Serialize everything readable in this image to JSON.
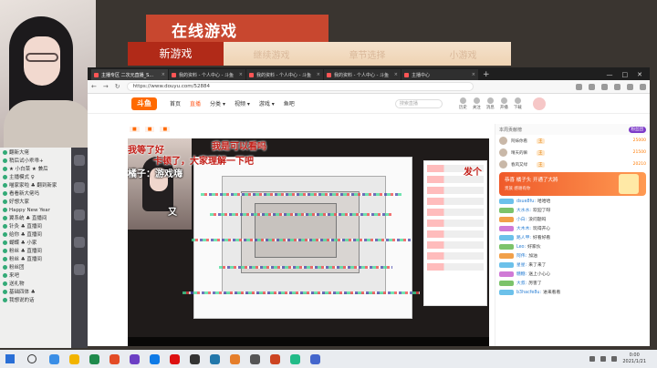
{
  "overlay": {
    "game_title": "在线游戏",
    "menu": [
      "新游戏",
      "继续游戏",
      "章节选择",
      "小游戏"
    ],
    "active_menu_index": 0
  },
  "browser": {
    "tabs": [
      {
        "label": "主播专区 二次元直播_S...",
        "active": true
      },
      {
        "label": "我的资料 - 个人中心 - 斗鱼",
        "active": false
      },
      {
        "label": "我的资料 - 个人中心 - 斗鱼",
        "active": false
      },
      {
        "label": "我的资料 - 个人中心 - 斗鱼",
        "active": false
      },
      {
        "label": "主播中心",
        "active": false
      }
    ],
    "new_tab": "+",
    "window_controls": [
      "—",
      "□",
      "✕"
    ],
    "nav_buttons": [
      "←",
      "→",
      "↻"
    ],
    "url": "https://www.douyu.com/52884"
  },
  "site": {
    "logo": "斗鱼",
    "nav": [
      {
        "label": "首页",
        "active": false
      },
      {
        "label": "直播",
        "active": true
      },
      {
        "label": "分类 ▾",
        "active": false
      },
      {
        "label": "视频 ▾",
        "active": false
      },
      {
        "label": "游戏 ▾",
        "active": false
      },
      {
        "label": "鱼吧",
        "active": false
      }
    ],
    "search_placeholder": "搜索直播",
    "header_icons": [
      "历史",
      "关注",
      "消息",
      "开播",
      "下载"
    ]
  },
  "player": {
    "danmu": [
      {
        "text": "我是可以看吗",
        "style": "red"
      },
      {
        "text": "我等了好",
        "style": "red"
      },
      {
        "text": "卡顿了，大家理解一下吧",
        "style": "red"
      },
      {
        "text": "橘子：游戏嗨",
        "style": "white"
      },
      {
        "text": "又",
        "style": "white"
      },
      {
        "text": "发个",
        "style": "red"
      }
    ]
  },
  "chat_panel": {
    "header": "本周贡献榜",
    "header_pill": "粉丝团",
    "ranks": [
      {
        "name": "阿妹你看",
        "badge": "王",
        "score": "25000"
      },
      {
        "name": "晴天的嘛",
        "badge": "王",
        "score": "21500"
      },
      {
        "name": "春风又绿",
        "badge": "王",
        "score": "20210"
      }
    ],
    "gift_banner": {
      "line1": "恭喜 橘子头 开通了大將",
      "line2": "贵族  感谢有你"
    },
    "messages": [
      {
        "lv": "b",
        "name": "dsue8fu:",
        "text": "哈哈哈"
      },
      {
        "lv": "g",
        "name": "大水水:",
        "text": "欢迎了呀"
      },
      {
        "lv": "o",
        "name": "小白:",
        "text": "没问题吗"
      },
      {
        "lv": "p",
        "name": "大木木:",
        "text": "玩得开心"
      },
      {
        "lv": "b",
        "name": "路人甲:",
        "text": "好看好看"
      },
      {
        "lv": "g",
        "name": "Leo:",
        "text": "好家伙"
      },
      {
        "lv": "o",
        "name": "阿伟:",
        "text": "加油"
      },
      {
        "lv": "b",
        "name": "星星:",
        "text": "来了来了"
      },
      {
        "lv": "p",
        "name": "糖糖:",
        "text": "送上小心心"
      },
      {
        "lv": "g",
        "name": "大叔:",
        "text": "厉害了"
      },
      {
        "lv": "b",
        "name": "b3hacfe8u:",
        "text": "进来看看"
      }
    ]
  },
  "left_chat": {
    "lines": [
      "翻新大佬",
      "稍后试小乖乖+",
      "★ 小白菜 ★ 兼后",
      "主播模式 ♀",
      "喵家家啦 ♣ 翻到新家",
      "看看新大佬吗",
      "好想大家",
      "Happy New Year",
      "翼系统 ♣ 直播间",
      "针灸 ♣ 直播间",
      "给你 ♣ 直播间",
      "蝴蝶 ♣ 小家",
      "粉丝 ♣ 直播间",
      "粉丝 ♣ 直播间",
      "粉丝团",
      "来吧",
      "送礼物",
      "基础四体 ♣",
      "我想说的话"
    ]
  },
  "taskbar": {
    "time": "0:00",
    "date": "2021/1/21"
  },
  "colors": {
    "brand": "#ff6a00",
    "banner_red": "#c8472f",
    "danmu_red": "#c21d16"
  }
}
